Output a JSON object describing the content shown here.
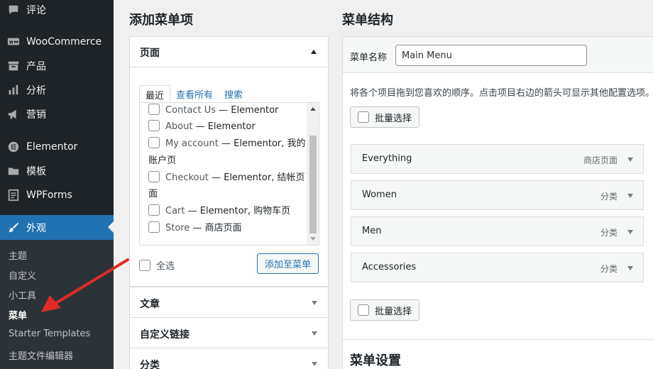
{
  "sidebar": {
    "items": [
      {
        "label": "评论",
        "icon": "comment-icon"
      },
      {
        "label": "WooCommerce",
        "icon": "woo-icon"
      },
      {
        "label": "产品",
        "icon": "archive-icon"
      },
      {
        "label": "分析",
        "icon": "bar-chart-icon"
      },
      {
        "label": "营销",
        "icon": "megaphone-icon"
      },
      {
        "label": "Elementor",
        "icon": "elementor-icon"
      },
      {
        "label": "模板",
        "icon": "folder-icon"
      },
      {
        "label": "WPForms",
        "icon": "form-icon"
      },
      {
        "label": "外观",
        "icon": "paintbrush-icon"
      }
    ],
    "submenu": [
      "主题",
      "自定义",
      "小工具",
      "菜单",
      "Starter Templates",
      "主题文件编辑器"
    ]
  },
  "add_items": {
    "heading": "添加菜单项",
    "pages_section": {
      "title": "页面",
      "tabs": [
        "最近",
        "查看所有",
        "搜索"
      ],
      "pages": [
        {
          "name": "Contact Us",
          "suffix": "— Elementor"
        },
        {
          "name": "About",
          "suffix": "— Elementor"
        },
        {
          "name": "My account",
          "suffix": "— Elementor, 我的",
          "cont": "账户页"
        },
        {
          "name": "Checkout",
          "suffix": "— Elementor, 结帐页",
          "cont": "面"
        },
        {
          "name": "Cart",
          "suffix": "— Elementor, 购物车页"
        },
        {
          "name": "Store",
          "suffix": "— 商店页面"
        }
      ],
      "select_all": "全选",
      "add_button": "添加至菜单"
    },
    "other_sections": [
      "文章",
      "自定义链接",
      "分类"
    ]
  },
  "structure": {
    "heading": "菜单结构",
    "menu_name_label": "菜单名称",
    "menu_name_value": "Main Menu",
    "instruction": "将各个项目拖到您喜欢的顺序。点击项目右边的箭头可显示其他配置选项。",
    "bulk_select": "批量选择",
    "items": [
      {
        "title": "Everything",
        "type": "商店页面"
      },
      {
        "title": "Women",
        "type": "分类"
      },
      {
        "title": "Men",
        "type": "分类"
      },
      {
        "title": "Accessories",
        "type": "分类"
      }
    ],
    "settings_heading": "菜单设置"
  },
  "colors": {
    "accent": "#2271b1",
    "sidebar_bg": "#1d2327",
    "arrow": "#e02b27"
  }
}
